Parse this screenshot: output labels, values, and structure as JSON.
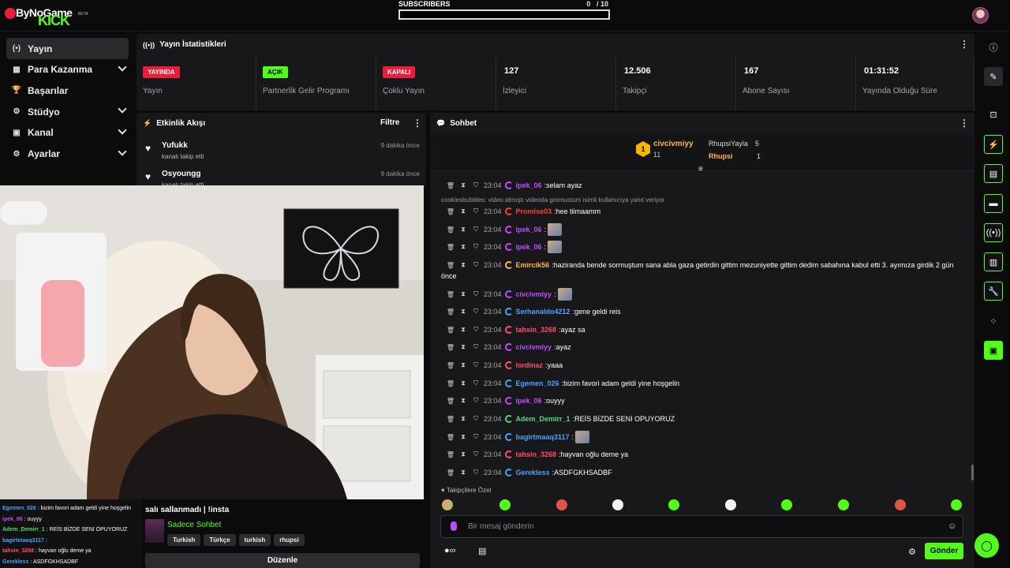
{
  "app": {
    "brand_text": "ByNoGame",
    "brand_sub": "KICK",
    "brand_beta": "BETA"
  },
  "subs": {
    "label": "SUBSCRIBERS",
    "count": "0",
    "sep": "/",
    "goal": "10",
    "progress": 0
  },
  "sidebar": {
    "items": [
      {
        "label": "Yayın",
        "icon": "(•)",
        "active": true,
        "chevron": false
      },
      {
        "label": "Para Kazanma",
        "icon": "▦",
        "active": false,
        "chevron": true
      },
      {
        "label": "Başarılar",
        "icon": "🏆",
        "active": false,
        "chevron": false
      },
      {
        "label": "Stüdyo",
        "icon": "⚙",
        "active": false,
        "chevron": true
      },
      {
        "label": "Kanal",
        "icon": "▣",
        "active": false,
        "chevron": true
      },
      {
        "label": "Ayarlar",
        "icon": "⚙",
        "active": false,
        "chevron": true
      }
    ]
  },
  "stats": {
    "title": "Yayın İstatistikleri",
    "items": [
      {
        "badge": "YAYINDA",
        "badge_color": "#e91e3a",
        "label": "Yayın"
      },
      {
        "badge": "AÇIK",
        "badge_color": "#53fc18",
        "label": "Partnerlik Gelir Programı"
      },
      {
        "badge": "KAPALI",
        "badge_color": "#e91e3a",
        "label": "Çoklu Yayın"
      },
      {
        "value": "127",
        "label": "İzleyici"
      },
      {
        "value": "12.506",
        "label": "Takipçi"
      },
      {
        "value": "167",
        "label": "Abone Sayısı"
      },
      {
        "value": "01:31:52",
        "label": "Yayında Olduğu Süre"
      }
    ]
  },
  "activity": {
    "title": "Etkinlik Akışı",
    "filter": "Filtre",
    "items": [
      {
        "name": "Yufukk",
        "desc": "kanalı takip etti",
        "time": "9 dakika önce"
      },
      {
        "name": "Osyoungg",
        "desc": "kanalı takip etti",
        "time": "9 dakika önce"
      }
    ]
  },
  "stream": {
    "title": "salı sallanmadı | !insta",
    "category": "Sadece Sohbet",
    "tags": [
      "Turkish",
      "Türkçe",
      "turkish",
      "rhupsi"
    ],
    "edit": "Düzenle"
  },
  "overlay_chat": [
    {
      "user": "Egemen_026",
      "color": "#4ea1ff",
      "text": "bizim favori adam geldi yine hoşgelin"
    },
    {
      "user": "ipek_06",
      "color": "#c04dff",
      "text": "ouyyy"
    },
    {
      "user": "Adem_Demirr_1",
      "color": "#4cd97b",
      "text": "REİS BİZDE SENI OPUYORUZ"
    },
    {
      "user": "bagirtmaaq3117",
      "color": "#4ea1ff",
      "text": ""
    },
    {
      "user": "tahsin_3268",
      "color": "#ff4f6b",
      "text": "hayvan oğlu deme ya"
    },
    {
      "user": "Gerekless",
      "color": "#4ea1ff",
      "text": "ASDFGKHSADBF"
    }
  ],
  "chat": {
    "title": "Sohbet",
    "leaderboard": {
      "first_name": "civcivmiyy",
      "first_count": "11",
      "rank": "1",
      "second_name": "RhupsiYayla",
      "second_count": "5",
      "third_name": "Rhupsi",
      "third_count": "1"
    },
    "reply_note": "cookiesbubbles: video atmıştı videoda gormustum isimli kullanıcıya yanıt veriyor",
    "messages": [
      {
        "time": "23:04",
        "user": "ipek_06",
        "color": "#c04dff",
        "text": "selam ayaz",
        "emote": false
      },
      {
        "time": "23:04",
        "user": "Promise03",
        "color": "#ff3d3d",
        "text": "hee tiimaamm",
        "emote": false
      },
      {
        "time": "23:04",
        "user": "ipek_06",
        "color": "#c04dff",
        "text": "",
        "emote": true
      },
      {
        "time": "23:04",
        "user": "ipek_06",
        "color": "#c04dff",
        "text": "",
        "emote": true
      },
      {
        "time": "23:04",
        "user": "Emircik56",
        "color": "#ffb84d",
        "text": "haziranda bende sormuştum sana abla gaza getirdin gittim mezuniyette gittim dedim sabahına kabul etti 3. ayımıza girdik 2 gün",
        "emote": false
      },
      {
        "time": "23:04",
        "user": "civcivmiyy",
        "color": "#c04dff",
        "text": "",
        "emote": true
      },
      {
        "time": "23:04",
        "user": "Serhanaldo4212",
        "color": "#4ea1ff",
        "text": "gene geldi reis",
        "emote": false
      },
      {
        "time": "23:04",
        "user": "tahsin_3268",
        "color": "#ff4f6b",
        "text": "ayaz sa",
        "emote": false
      },
      {
        "time": "23:04",
        "user": "civcivmiyy",
        "color": "#c04dff",
        "text": "ayaz",
        "emote": false
      },
      {
        "time": "23:04",
        "user": "lordinaz",
        "color": "#ff4f6b",
        "text": "yaaa",
        "emote": false
      },
      {
        "time": "23:04",
        "user": "Egemen_026",
        "color": "#4ea1ff",
        "text": "bizim favori adam geldi yine hoşgelin",
        "emote": false
      },
      {
        "time": "23:04",
        "user": "ipek_06",
        "color": "#c04dff",
        "text": "ouyyy",
        "emote": false
      },
      {
        "time": "23:04",
        "user": "Adem_Demirr_1",
        "color": "#4cd97b",
        "text": "REİS BİZDE SENI OPUYORUZ",
        "emote": false
      },
      {
        "time": "23:04",
        "user": "bagirtmaaq3117",
        "color": "#4ea1ff",
        "text": "",
        "emote": true
      },
      {
        "time": "23:04",
        "user": "tahsin_3268",
        "color": "#ff4f6b",
        "text": "hayvan oğlu deme ya",
        "emote": false
      },
      {
        "time": "23:04",
        "user": "Gerekless",
        "color": "#4ea1ff",
        "text": "ASDFGKHSADBF",
        "emote": false
      }
    ],
    "wrap_continuation": "önce",
    "followers_only": "Takipçilere Özel",
    "input_placeholder": "Bir mesaj gönderin",
    "send": "Gönder"
  }
}
